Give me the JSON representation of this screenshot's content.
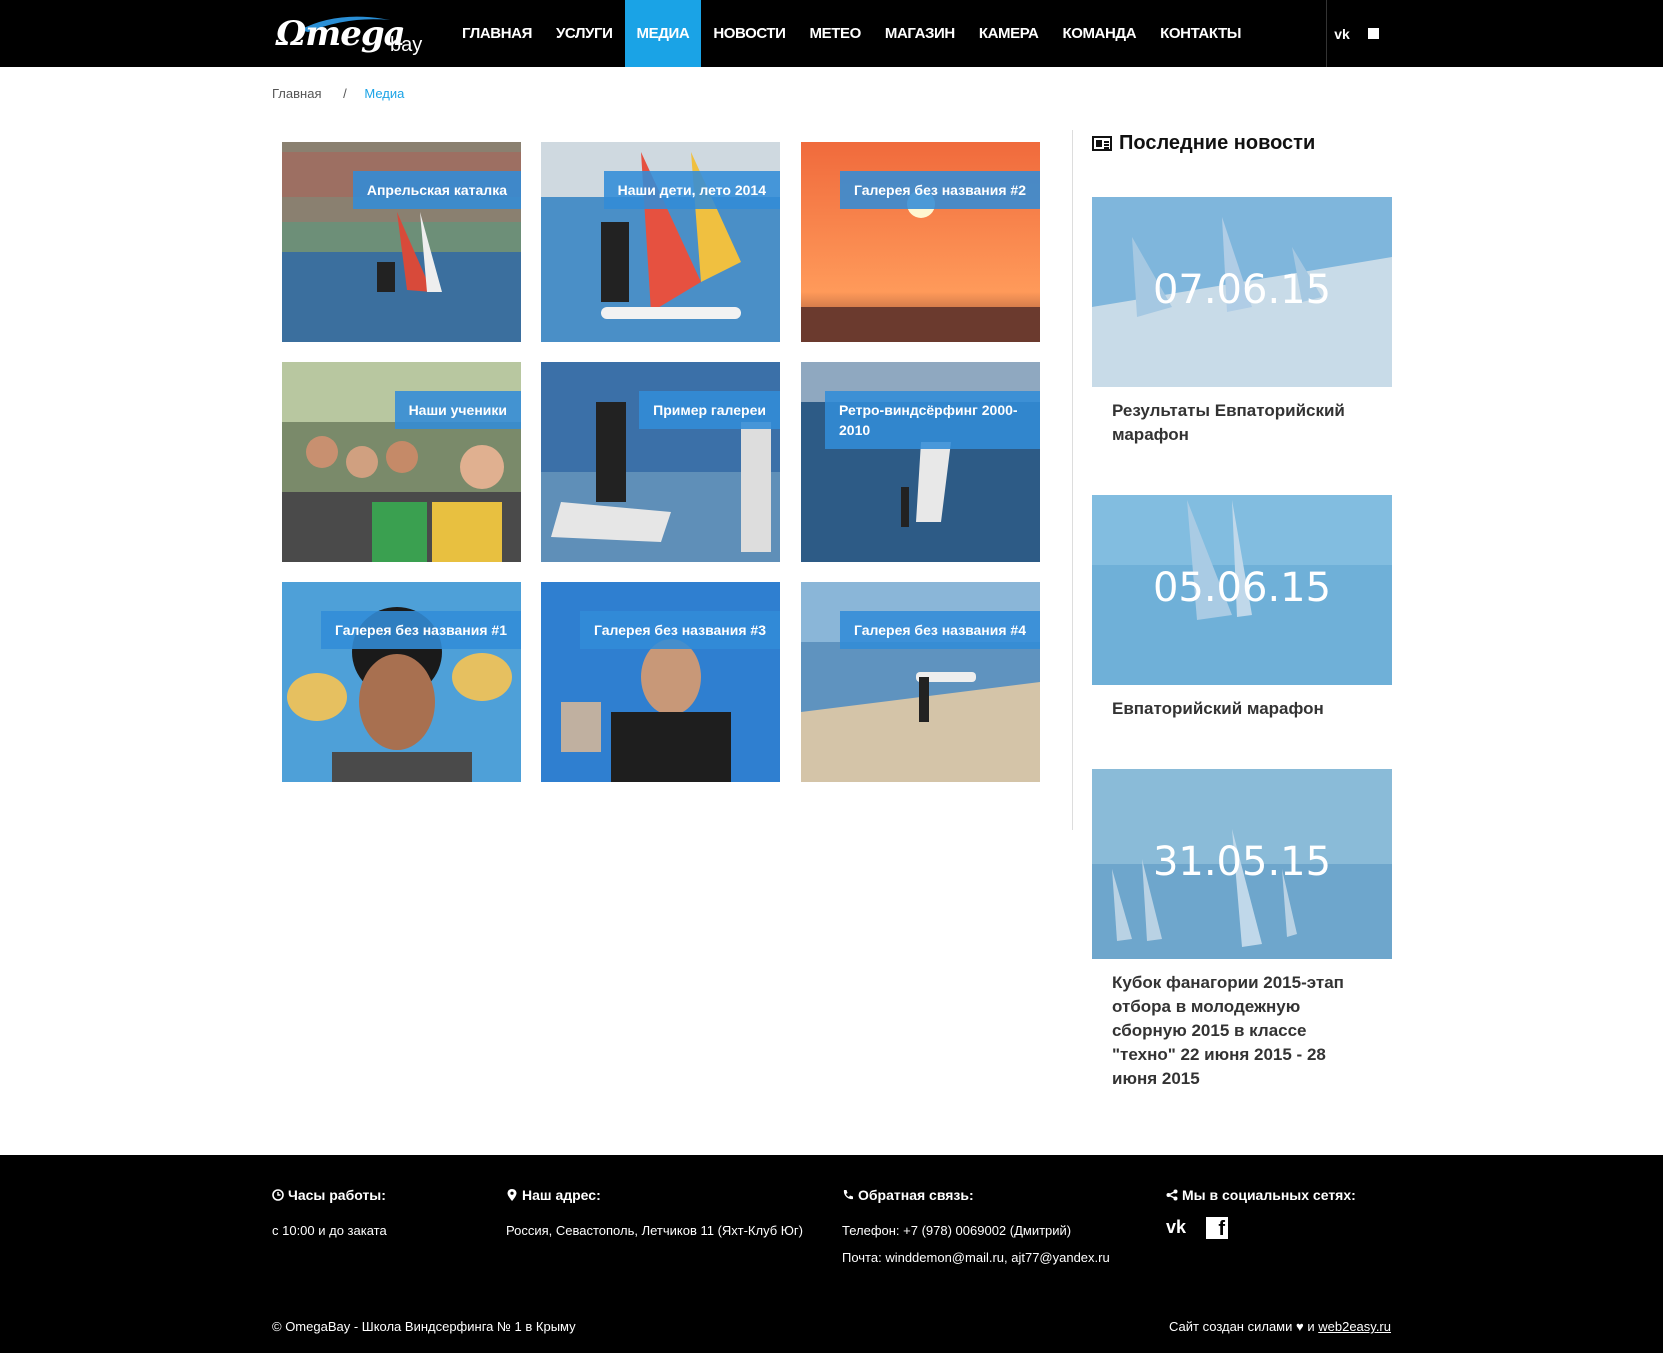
{
  "header": {
    "logo_text": "Ωmega",
    "logo_sub": "bay",
    "nav": [
      {
        "label": "ГЛАВНАЯ"
      },
      {
        "label": "УСЛУГИ"
      },
      {
        "label": "МЕДИА"
      },
      {
        "label": "НОВОСТИ"
      },
      {
        "label": "МЕТЕО"
      },
      {
        "label": "МАГАЗИН"
      },
      {
        "label": "КАМЕРА"
      },
      {
        "label": "КОМАНДА"
      },
      {
        "label": "КОНТАКТЫ"
      }
    ],
    "active_nav": "МЕДИА",
    "social_vk": "vk",
    "social_fb": "f",
    "accent_color": "#1aa3e6"
  },
  "breadcrumb": {
    "home": "Главная",
    "separator": "/",
    "current": "Медиа"
  },
  "gallery": [
    {
      "label": "Апрельская каталка"
    },
    {
      "label": "Наши дети, лето 2014"
    },
    {
      "label": "Галерея без названия #2"
    },
    {
      "label": "Наши ученики"
    },
    {
      "label": "Пример галереи"
    },
    {
      "label": "Ретро-виндсёрфинг 2000-2010"
    },
    {
      "label": "Галерея без названия #1"
    },
    {
      "label": "Галерея без названия #3"
    },
    {
      "label": "Галерея без названия #4"
    }
  ],
  "sidebar": {
    "title": "Последние новости",
    "news": [
      {
        "date": "07.06.15",
        "title": "Результаты Евпаторийский марафон"
      },
      {
        "date": "05.06.15",
        "title": "Евпаторийский марафон"
      },
      {
        "date": "31.05.15",
        "title": "Кубок фанагории 2015-этап отбора в молодежную сборную 2015 в классе \"техно\" 22 июня 2015 - 28 июня 2015"
      }
    ]
  },
  "footer": {
    "hours_title": "Часы работы:",
    "hours_text": "с 10:00 и до заката",
    "address_title": "Наш адрес:",
    "address_text": "Россия, Севастополь, Летчиков 11 (Яхт-Клуб Юг)",
    "contact_title": "Обратная связь:",
    "phone": "Телефон: +7 (978) 0069002 (Дмитрий)",
    "email": "Почта: winddemon@mail.ru, ajt77@yandex.ru",
    "social_title": "Мы в социальных сетях:",
    "social_vk": "vk",
    "social_fb": "f",
    "copyright": "© OmegaBay - Школа Виндсерфинга № 1 в Крыму",
    "made_by_prefix": "Сайт создан силами",
    "made_by_and": "и",
    "made_by_link": "web2easy.ru"
  }
}
